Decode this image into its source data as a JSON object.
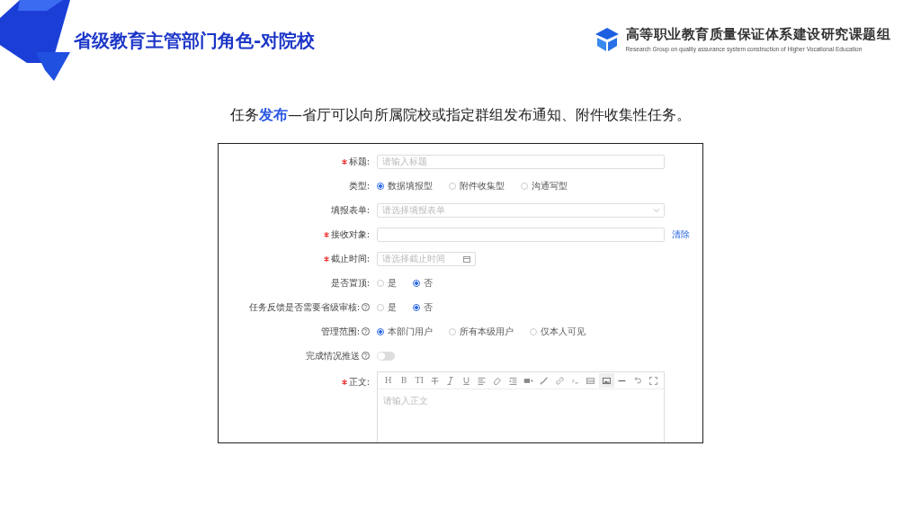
{
  "header": {
    "title": "省级教育主管部门角色-对院校",
    "logo": {
      "title": "高等职业教育质量保证体系建设研究课题组",
      "subtitle": "Research Group on quality assurance system construction of Higher Vocational Education"
    }
  },
  "caption": "任务**发布**—省厅可以向所属院校或指定群组发布通知、附件收集性任务。",
  "form": {
    "fields": [
      {
        "kind": "input",
        "label": "标题:",
        "required": true,
        "help": false,
        "placeholder": "请输入标题"
      },
      {
        "kind": "radio",
        "label": "类型:",
        "required": false,
        "help": false,
        "options": [
          {
            "label": "数据填报型",
            "selected": true
          },
          {
            "label": "附件收集型",
            "selected": false
          },
          {
            "label": "沟通写型",
            "selected": false
          }
        ]
      },
      {
        "kind": "select",
        "label": "填报表单:",
        "required": false,
        "help": false,
        "placeholder": "请选择填报表单"
      },
      {
        "kind": "input",
        "label": "接收对象:",
        "required": true,
        "help": false,
        "action": "清除"
      },
      {
        "kind": "date",
        "label": "截止时间:",
        "required": true,
        "help": false,
        "placeholder": "请选择截止时间"
      },
      {
        "kind": "radio",
        "label": "是否置顶:",
        "required": false,
        "help": false,
        "options": [
          {
            "label": "是",
            "selected": false
          },
          {
            "label": "否",
            "selected": true
          }
        ]
      },
      {
        "kind": "radio",
        "label": "任务反馈是否需要省级审核:",
        "required": false,
        "help": true,
        "options": [
          {
            "label": "是",
            "selected": false
          },
          {
            "label": "否",
            "selected": true
          }
        ]
      },
      {
        "kind": "radio",
        "label": "管理范围:",
        "required": false,
        "help": true,
        "options": [
          {
            "label": "本部门用户",
            "selected": true
          },
          {
            "label": "所有本级用户",
            "selected": false
          },
          {
            "label": "仅本人可见",
            "selected": false
          }
        ]
      },
      {
        "kind": "switch",
        "label": "完成情况推送",
        "required": false,
        "help": true,
        "on": false
      },
      {
        "kind": "editor",
        "label": "正文:",
        "required": true,
        "help": false,
        "placeholder": "请输入正文",
        "toolbar": [
          {
            "kind": "text",
            "label": "H",
            "selected": false
          },
          {
            "kind": "text",
            "label": "B",
            "selected": false
          },
          {
            "kind": "text",
            "label": "TI",
            "selected": false
          },
          {
            "kind": "strike",
            "selected": false
          },
          {
            "kind": "italic",
            "selected": false
          },
          {
            "kind": "underline",
            "selected": false
          },
          {
            "kind": "align",
            "selected": false
          },
          {
            "kind": "eraser",
            "selected": false
          },
          {
            "kind": "indent",
            "selected": false
          },
          {
            "kind": "video",
            "selected": false
          },
          {
            "kind": "brush",
            "selected": false
          },
          {
            "kind": "link",
            "selected": false
          },
          {
            "kind": "code",
            "selected": false
          },
          {
            "kind": "table",
            "selected": false
          },
          {
            "kind": "image",
            "selected": true
          },
          {
            "kind": "rule",
            "selected": false
          },
          {
            "kind": "undo",
            "selected": false
          },
          {
            "kind": "fullscreen",
            "selected": false
          }
        ]
      }
    ]
  }
}
